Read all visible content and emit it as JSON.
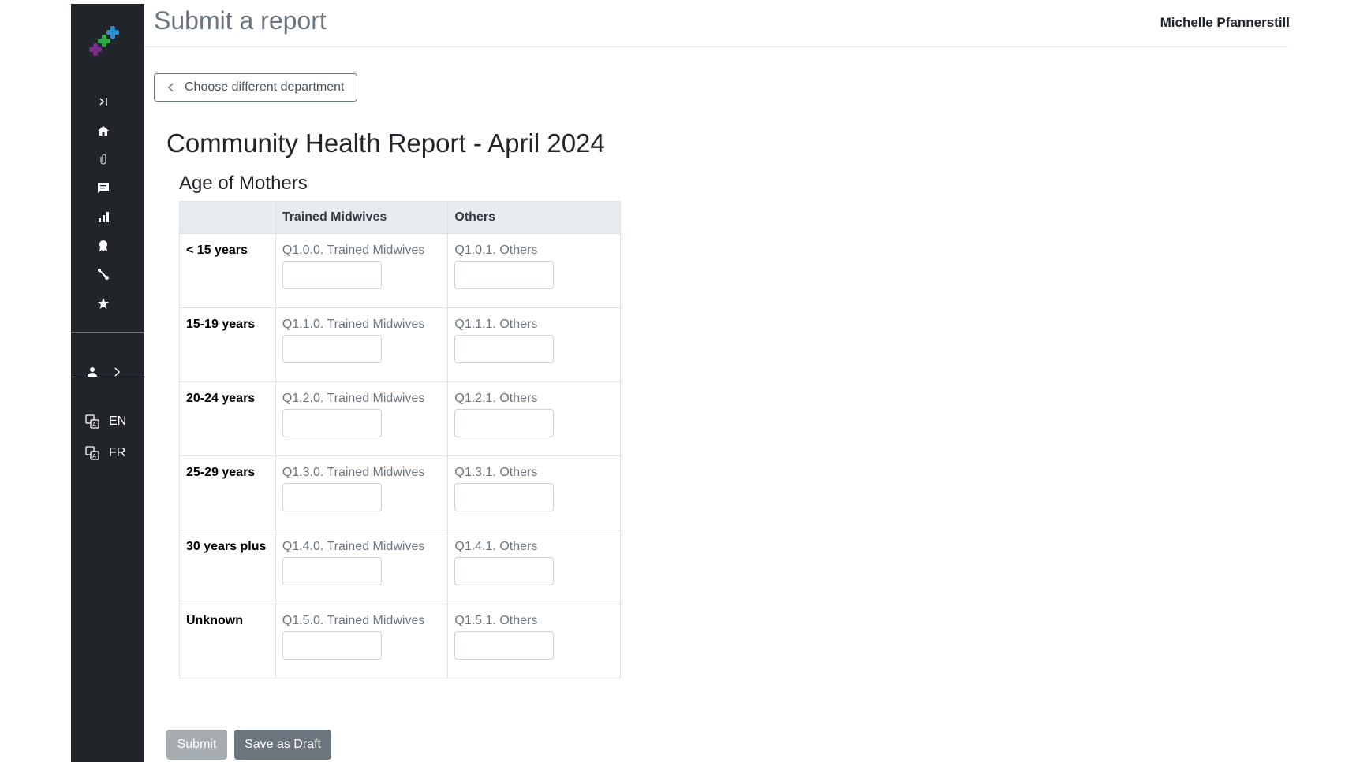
{
  "header": {
    "page_title": "Submit a report",
    "user_name": "Michelle Pfannerstill"
  },
  "sidebar": {
    "icons": [
      "collapse-icon",
      "home-icon",
      "paperclip-icon",
      "message-icon",
      "chart-icon",
      "award-icon",
      "wrench-icon",
      "star-icon"
    ],
    "languages": [
      {
        "code": "EN"
      },
      {
        "code": "FR"
      }
    ]
  },
  "back_button": {
    "label": "Choose different department"
  },
  "report": {
    "title": "Community Health Report - April 2024",
    "section_title": "Age of Mothers",
    "columns": [
      "",
      "Trained Midwives",
      "Others"
    ],
    "rows": [
      {
        "label": "< 15 years",
        "q0": "Q1.0.0. Trained Midwives",
        "q1": "Q1.0.1. Others",
        "v0": "",
        "v1": ""
      },
      {
        "label": "15-19 years",
        "q0": "Q1.1.0. Trained Midwives",
        "q1": "Q1.1.1. Others",
        "v0": "",
        "v1": ""
      },
      {
        "label": "20-24 years",
        "q0": "Q1.2.0. Trained Midwives",
        "q1": "Q1.2.1. Others",
        "v0": "",
        "v1": ""
      },
      {
        "label": "25-29 years",
        "q0": "Q1.3.0. Trained Midwives",
        "q1": "Q1.3.1. Others",
        "v0": "",
        "v1": ""
      },
      {
        "label": "30 years plus",
        "q0": "Q1.4.0. Trained Midwives",
        "q1": "Q1.4.1. Others",
        "v0": "",
        "v1": ""
      },
      {
        "label": "Unknown",
        "q0": "Q1.5.0. Trained Midwives",
        "q1": "Q1.5.1. Others",
        "v0": "",
        "v1": ""
      }
    ]
  },
  "actions": {
    "submit_label": "Submit",
    "draft_label": "Save as Draft"
  },
  "colors": {
    "sidebar_bg": "#212529",
    "submit_disabled": "#a7acb1",
    "secondary": "#6c757d"
  }
}
